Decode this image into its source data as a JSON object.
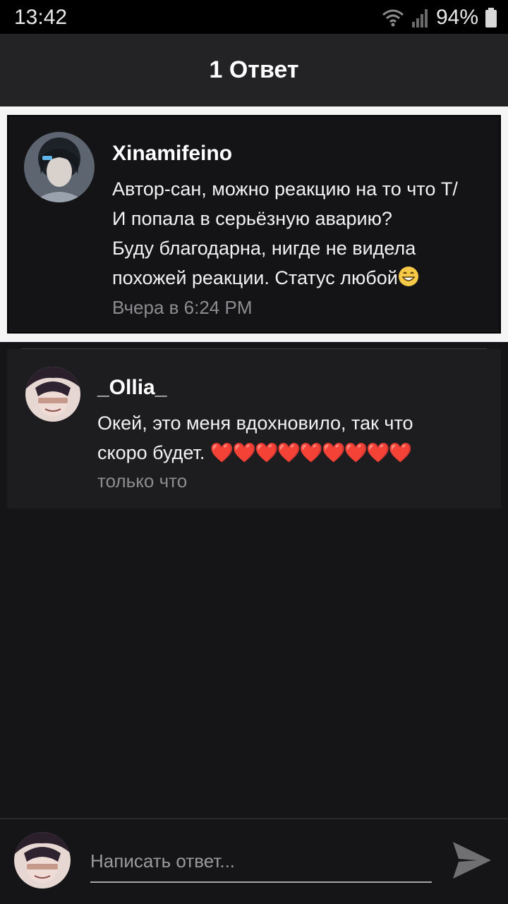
{
  "status_bar": {
    "time": "13:42",
    "battery": "94%",
    "icons": [
      "wifi-icon",
      "signal-icon",
      "battery-icon"
    ]
  },
  "header": {
    "title": "1 Ответ"
  },
  "parent_comment": {
    "author": "Xinamifeino",
    "text": "Автор-сан, можно реакцию на то что Т/\nИ попала в серьёзную аварию?\nБуду благодарна, нигде не видела\nпохожей реакции. Статус любой",
    "emoji": "grinning-face-icon",
    "time": "Вчера в 6:24 PM"
  },
  "reply_comment": {
    "author": "_Ollia_",
    "text": "Окей, это меня вдохновило, так что\nскоро будет. ",
    "hearts": "❤️❤️❤️❤️❤️❤️❤️❤️❤️",
    "time": "только что"
  },
  "composer": {
    "placeholder": "Написать ответ...",
    "send_icon": "send-icon"
  },
  "colors": {
    "background": "#151416",
    "header": "#232224",
    "card": "#141316",
    "reply_card": "#1d1c1f",
    "heart": "#e02222"
  }
}
